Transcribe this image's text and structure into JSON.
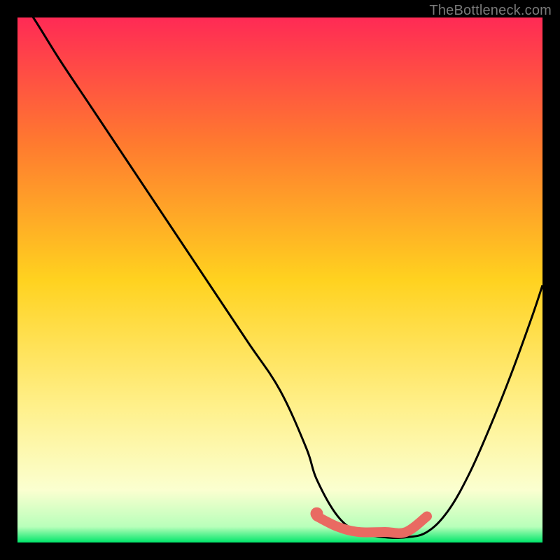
{
  "watermark": "TheBottleneck.com",
  "colors": {
    "page_bg": "#000000",
    "gradient_top": "#ff2a55",
    "gradient_mid_upper": "#ff7a2f",
    "gradient_mid": "#ffd21f",
    "gradient_mid_lower": "#fff08a",
    "gradient_lower": "#fbffd0",
    "gradient_bottom": "#00e66a",
    "curve": "#000000",
    "highlight": "#e96a62"
  },
  "chart_data": {
    "type": "line",
    "title": "",
    "xlabel": "",
    "ylabel": "",
    "xlim": [
      0,
      100
    ],
    "ylim": [
      0,
      100
    ],
    "grid": false,
    "series": [
      {
        "name": "bottleneck-curve",
        "x": [
          0,
          3,
          8,
          14,
          20,
          26,
          32,
          38,
          44,
          50,
          55,
          57,
          61,
          65,
          70,
          74,
          78,
          82,
          86,
          90,
          94,
          98,
          100
        ],
        "y": [
          104,
          100,
          92,
          83,
          74,
          65,
          56,
          47,
          38,
          29,
          18,
          12,
          5,
          2,
          1,
          1,
          2,
          6,
          13,
          22,
          32,
          43,
          49
        ]
      }
    ],
    "highlight_segment": {
      "name": "flat-bottom",
      "x": [
        57,
        61,
        65,
        70,
        74,
        78
      ],
      "y": [
        5,
        3,
        2,
        2,
        2,
        5
      ]
    },
    "highlight_dot": {
      "x": 57,
      "y": 5.5
    }
  }
}
